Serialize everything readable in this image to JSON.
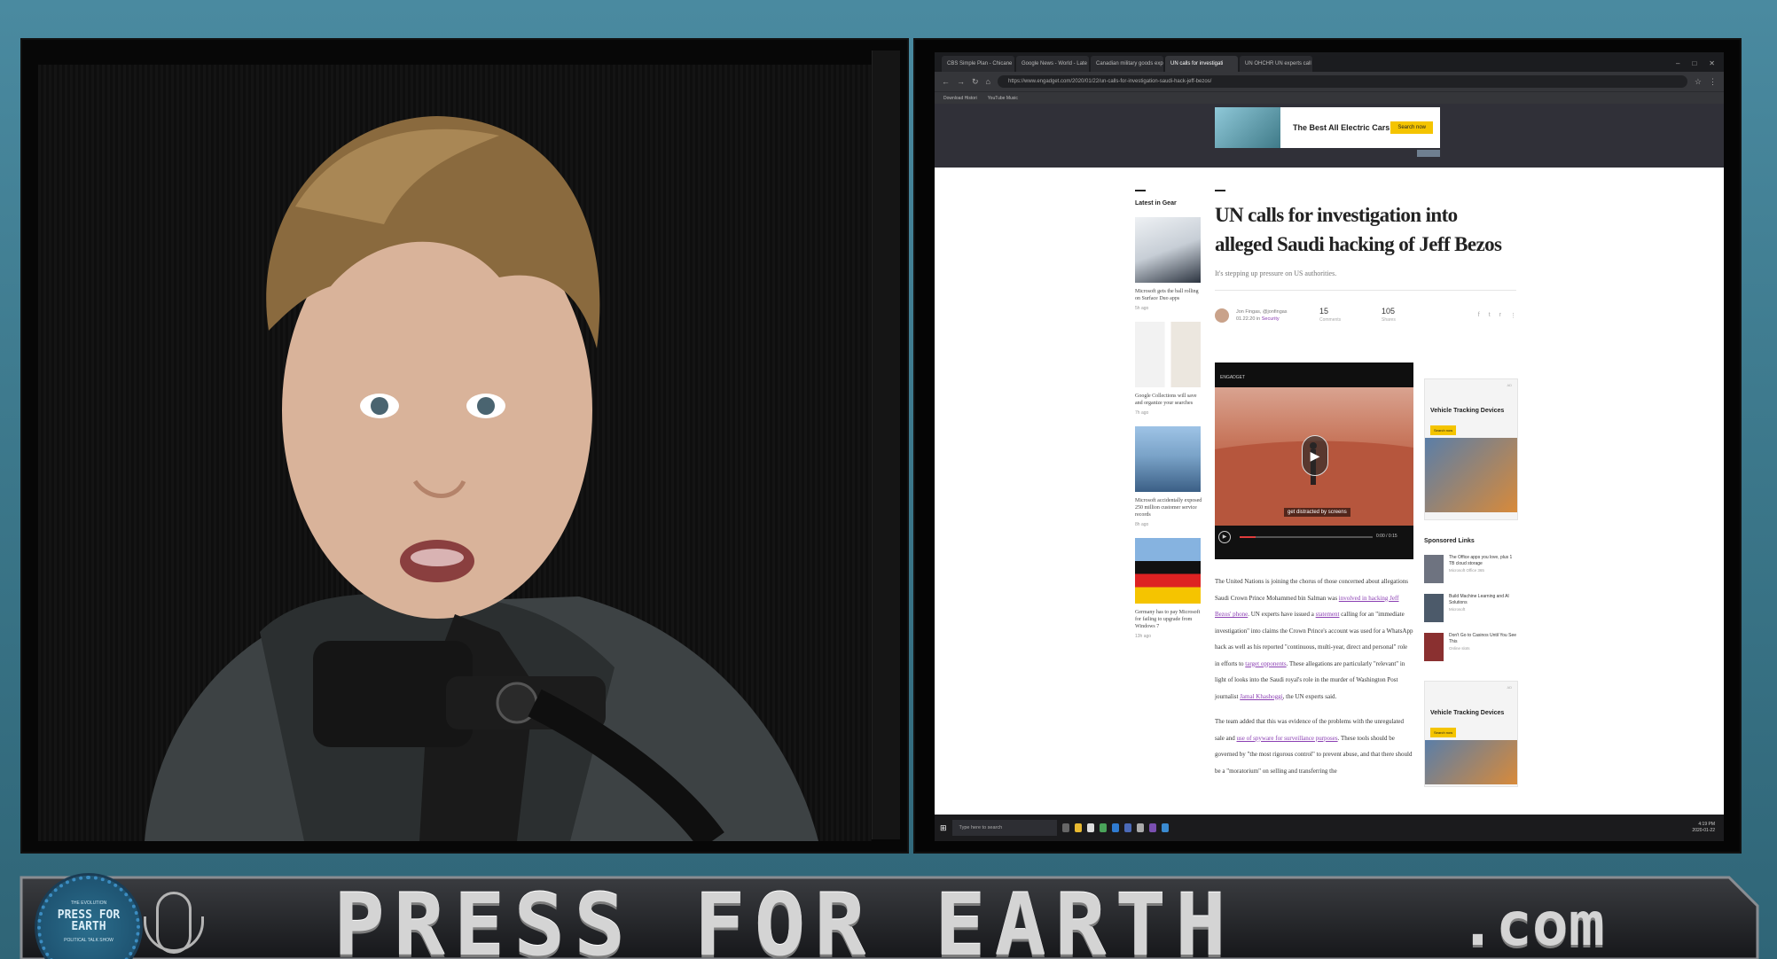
{
  "browser": {
    "tabs": [
      {
        "label": "CBS Simple Plan - Chicane",
        "active": false
      },
      {
        "label": "Google News - World - Late",
        "active": false
      },
      {
        "label": "Canadian military goods exp",
        "active": false
      },
      {
        "label": "UN calls for investigati",
        "active": true
      },
      {
        "label": "UN OHCHR UN experts call fo",
        "active": false
      }
    ],
    "url": "https://www.engadget.com/2020/01/22/un-calls-for-investigation-saudi-hack-jeff-bezos/",
    "bookmarks": [
      "Download Histori",
      "YouTube Music"
    ]
  },
  "ad_top": {
    "title": "The Best All Electric Cars",
    "button": "Search now"
  },
  "sidebar_left": {
    "heading": "Latest in Gear",
    "items": [
      {
        "title": "Microsoft gets the ball rolling on Surface Duo apps",
        "time": "5h ago"
      },
      {
        "title": "Google Collections will save and organize your searches",
        "time": "7h ago"
      },
      {
        "title": "Microsoft accidentally exposed 250 million customer service records",
        "time": "8h ago"
      },
      {
        "title": "Germany has to pay Microsoft for failing to upgrade from Windows 7",
        "time": "13h ago"
      }
    ]
  },
  "article": {
    "title": "UN calls for investigation into alleged Saudi hacking of Jeff Bezos",
    "subtitle": "It's stepping up pressure on US authorities.",
    "author": "Jon Fingas, @jonfingas",
    "section_prefix": "01.22.20 in ",
    "section": "Security",
    "comments_count": "15",
    "comments_label": "Comments",
    "shares_count": "105",
    "shares_label": "Shares",
    "video_label": "ENGADGET",
    "video_caption": "get distracted by screens",
    "video_time": "0:00 / 0:15",
    "body_1": "The United Nations is joining the chorus of those concerned about allegations Saudi Crown Prince Mohammed bin Salman was ",
    "link_1": "involved in hacking Jeff Bezos' phone",
    "body_2": ". UN experts have issued a ",
    "link_2": "statement",
    "body_3": " calling for an \"immediate investigation\" into claims the Crown Prince's account was used for a WhatsApp hack as well as his reported \"continuous, multi-year, direct and personal\" role in efforts to ",
    "link_3": "target opponents",
    "body_4": ". These allegations are particularly \"relevant\" in light of looks into the Saudi royal's role in the murder of Washington Post journalist ",
    "link_4": "Jamal Khashoggi",
    "body_5": ", the UN experts said.",
    "body_6": "The team added that this was evidence of the problems with the unregulated sale and ",
    "link_5": "use of spyware for surveillance purposes",
    "body_7": ". These tools should be governed by \"the most rigorous control\" to prevent abuse, and that there should be a \"moratorium\" on selling and transferring the"
  },
  "sidebar_right": {
    "ad_title": "Vehicle Tracking Devices",
    "ad_button": "Search now",
    "ad_label": "AD",
    "sponsored_heading": "Sponsored Links",
    "sponsored": [
      {
        "title": "The Office apps you love, plus 1 TB cloud storage",
        "source": "Microsoft Office 365"
      },
      {
        "title": "Build Machine Learning and AI Solutions",
        "source": "Microsoft"
      },
      {
        "title": "Don't Go to Casinos Until You See This",
        "source": "Online slots"
      }
    ]
  },
  "taskbar": {
    "search_placeholder": "Type here to search",
    "time": "4:19 PM",
    "date": "2020-01-22"
  },
  "banner": {
    "logo_top": "THE EVOLUTION",
    "logo_main": "PRESS FOR EARTH",
    "logo_bottom": "POLITICAL TALK SHOW",
    "title": "PRESS FOR EARTH",
    "suffix": ".com"
  },
  "colors": {
    "link": "#8b3fb3",
    "accent_yellow": "#f4c400",
    "background_teal": "#3f7f92"
  }
}
